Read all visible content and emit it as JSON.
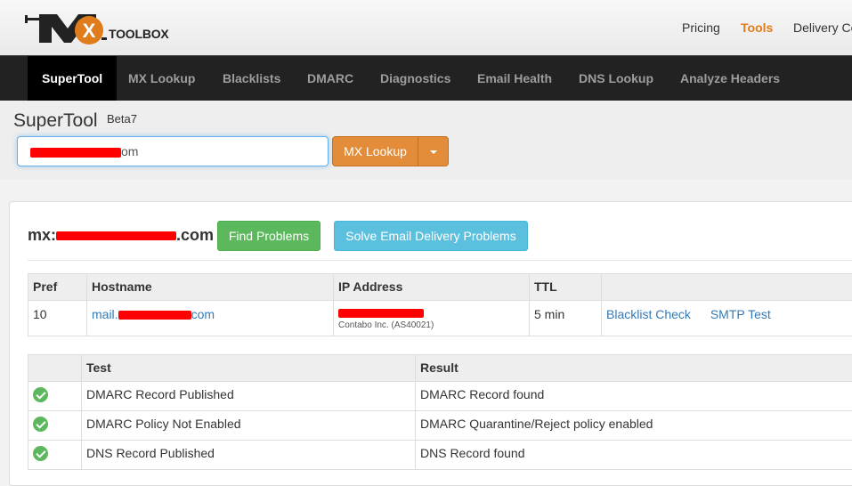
{
  "header": {
    "logo_text": "TOOLBOX",
    "nav_links": [
      "Pricing",
      "Tools",
      "Delivery Ce"
    ],
    "active_link": "Tools"
  },
  "navbar": {
    "items": [
      "SuperTool",
      "MX Lookup",
      "Blacklists",
      "DMARC",
      "Diagnostics",
      "Email Health",
      "DNS Lookup",
      "Analyze Headers"
    ],
    "active": "SuperTool"
  },
  "tool": {
    "title": "SuperTool",
    "beta": "Beta7",
    "search_value": "om",
    "lookup_button": "MX Lookup"
  },
  "result": {
    "domain_prefix": "mx:",
    "domain_suffix": ".com",
    "find_problems": "Find Problems",
    "solve_delivery": "Solve Email Delivery Problems"
  },
  "mx_table": {
    "headers": [
      "Pref",
      "Hostname",
      "IP Address",
      "TTL",
      ""
    ],
    "rows": [
      {
        "pref": "10",
        "hostname_prefix": "mail.",
        "hostname_suffix": "com",
        "ip_org": "Contabo Inc. (AS40021)",
        "ttl": "5 min",
        "action1": "Blacklist Check",
        "action2": "SMTP Test"
      }
    ]
  },
  "test_table": {
    "headers": [
      "",
      "Test",
      "Result"
    ],
    "rows": [
      {
        "test": "DMARC Record Published",
        "result": "DMARC Record found"
      },
      {
        "test": "DMARC Policy Not Enabled",
        "result": "DMARC Quarantine/Reject policy enabled"
      },
      {
        "test": "DNS Record Published",
        "result": "DNS Record found"
      }
    ]
  },
  "colors": {
    "accent_orange": "#e38d3b",
    "nav_dark": "#222222",
    "success_green": "#5cb85c",
    "info_blue": "#5bc0de",
    "link_blue": "#337ab7",
    "redaction_red": "#ff0000"
  }
}
